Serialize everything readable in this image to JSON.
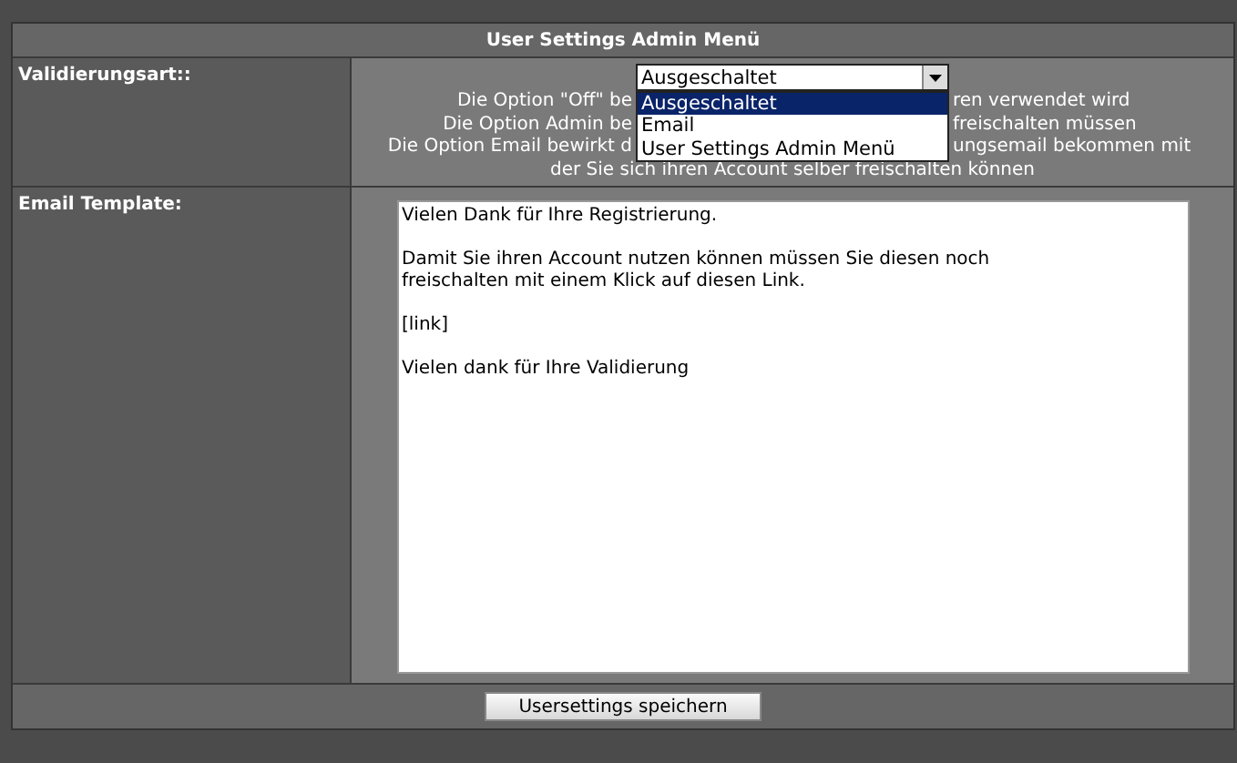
{
  "panel": {
    "title": "User Settings Admin Menü"
  },
  "validation": {
    "label": "Validierungsart::",
    "select": {
      "value": "Ausgeschaltet",
      "expanded": true,
      "options": [
        {
          "label": "Ausgeschaltet",
          "selected": true
        },
        {
          "label": "Email",
          "selected": false
        },
        {
          "label": "User Settings Admin Menü",
          "selected": false
        }
      ]
    },
    "description_lines": [
      {
        "left": "Die Option \"Off\" be",
        "right": "ren verwendet wird"
      },
      {
        "left": "Die Option Admin be",
        "right": "freischalten müssen"
      },
      {
        "left": "Die Option Email bewirkt d",
        "right": "ungsemail bekommen mit"
      },
      {
        "left": "der Sie sich ihren Account selber freischalten können"
      }
    ]
  },
  "email_template": {
    "label": "Email Template:",
    "value": "Vielen Dank für Ihre Registrierung.\n\nDamit Sie ihren Account nutzen können müssen Sie diesen noch\nfreischalten mit einem Klick auf diesen Link.\n\n[link]\n\nVielen dank für Ihre Validierung"
  },
  "save_button": {
    "label": "Usersettings speichern"
  }
}
